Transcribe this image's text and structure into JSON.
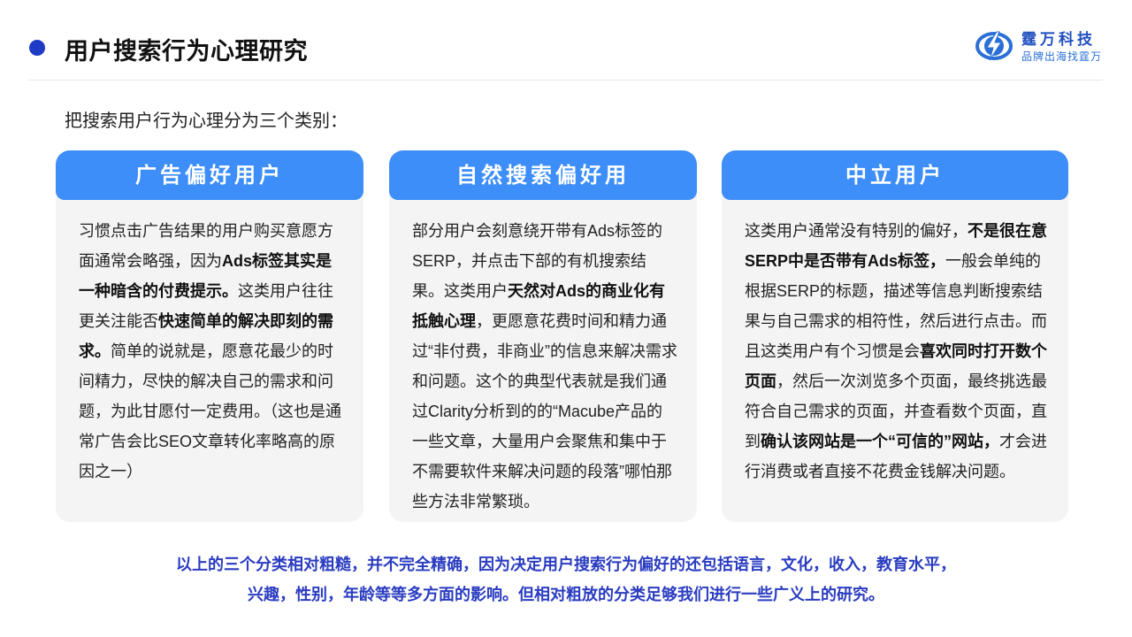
{
  "header": {
    "title": "用户搜索行为心理研究",
    "logo_name": "霆万科技",
    "logo_slogan": "品牌出海找霆万",
    "logo_icon": "lightning-bolt-icon"
  },
  "intro": "把搜索用户行为心理分为三个类别：",
  "cards": [
    {
      "title": "广告偏好用户",
      "body": [
        {
          "t": "习惯点击广告结果的用户购买意愿方面通常会略强，因为",
          "b": false
        },
        {
          "t": "Ads标签其实是一种暗含的付费提示。",
          "b": true
        },
        {
          "t": "这类用户往往更关注能否",
          "b": false
        },
        {
          "t": "快速简单的解决即刻的需求。",
          "b": true
        },
        {
          "t": "简单的说就是，愿意花最少的时间精力，尽快的解决自己的需求和问题，为此甘愿付一定费用。（这也是通常广告会比SEO文章转化率略高的原因之一）",
          "b": false
        }
      ]
    },
    {
      "title": "自然搜索偏好用",
      "body": [
        {
          "t": "部分用户会刻意绕开带有Ads标签的SERP，并点击下部的有机搜索结果。这类用户",
          "b": false
        },
        {
          "t": "天然对Ads的商业化有抵触心理",
          "b": true
        },
        {
          "t": "，更愿意花费时间和精力通过“非付费，非商业”的信息来解决需求和问题。这个的典型代表就是我们通过Clarity分析到的的“Macube产品的一些文章，大量用户会聚焦和集中于不需要软件来解决问题的段落”哪怕那些方法非常繁琐。",
          "b": false
        }
      ]
    },
    {
      "title": "中立用户",
      "body": [
        {
          "t": "这类用户通常没有特别的偏好，",
          "b": false
        },
        {
          "t": "不是很在意SERP中是否带有Ads标签，",
          "b": true
        },
        {
          "t": "一般会单纯的根据SERP的标题，描述等信息判断搜索结果与自己需求的相符性，然后进行点击。而且这类用户有个习惯是会",
          "b": false
        },
        {
          "t": "喜欢同时打开数个页面",
          "b": true
        },
        {
          "t": "，然后一次浏览多个页面，最终挑选最符合自己需求的页面，并查看数个页面，直到",
          "b": false
        },
        {
          "t": "确认该网站是一个“可信的”网站，",
          "b": true
        },
        {
          "t": "才会进行消费或者直接不花费金钱解决问题。",
          "b": false
        }
      ]
    }
  ],
  "summary": {
    "line1": "以上的三个分类相对粗糙，并不完全精确，因为决定用户搜索行为偏好的还包括语言，文化，收入，教育水平，",
    "line2": "兴趣，性别，年龄等等多方面的影响。但相对粗放的分类足够我们进行一些广义上的研究。"
  },
  "colors": {
    "accent": "#3d8ef8",
    "title_dot": "#1f3bc6",
    "summary_text": "#2a3cc0",
    "card_bg": "#f4f4f4"
  }
}
